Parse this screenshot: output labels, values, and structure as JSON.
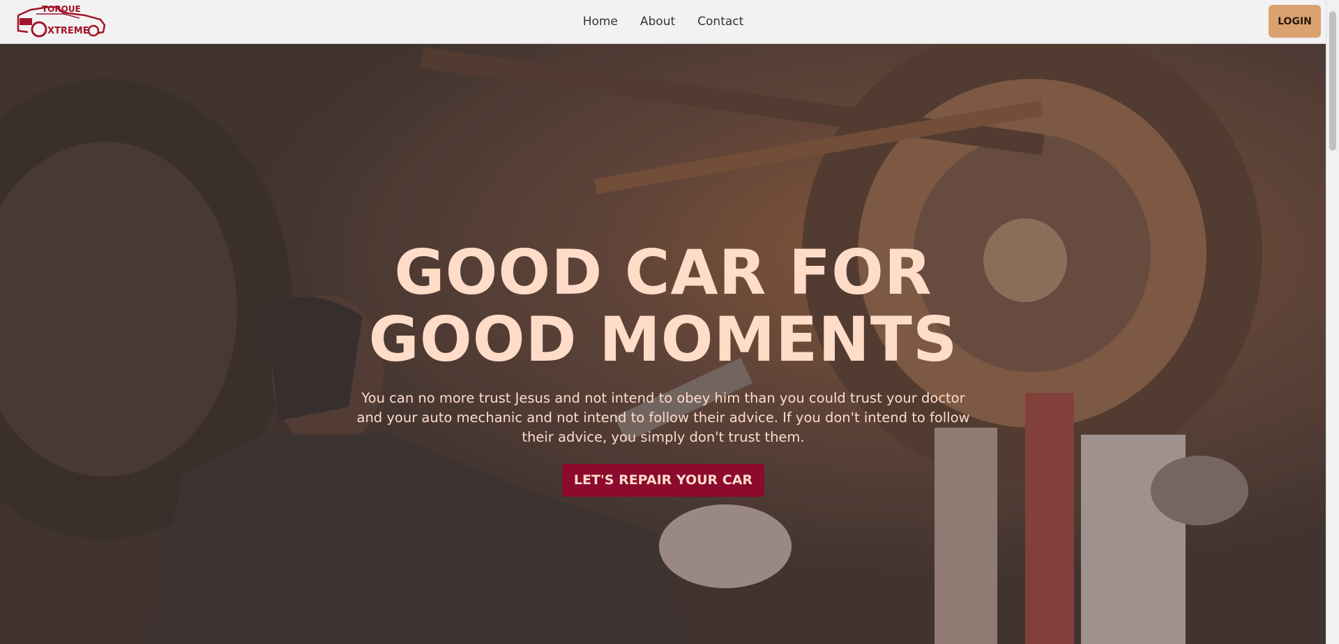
{
  "brand": {
    "logo_line1": "TORQUE",
    "logo_line2": "XTREME",
    "logo_letter": "E",
    "color": "#a3152a"
  },
  "nav": {
    "items": [
      {
        "label": "Home"
      },
      {
        "label": "About"
      },
      {
        "label": "Contact"
      }
    ],
    "login_label": "LOGIN"
  },
  "hero": {
    "title_line1": "GOOD CAR FOR",
    "title_line2": "GOOD MOMENTS",
    "text": "You can no more trust Jesus and not intend to obey him than you could trust your doctor and your auto mechanic and not intend to follow their advice. If you don't intend to follow their advice, you simply don't trust them.",
    "cta_label": "LET'S REPAIR YOUR CAR",
    "background_image": "mechanic working under a car on a lift"
  },
  "colors": {
    "accent": "#d9a26e",
    "cta": "#8b0a2e",
    "hero_text": "#ffdcc8"
  }
}
